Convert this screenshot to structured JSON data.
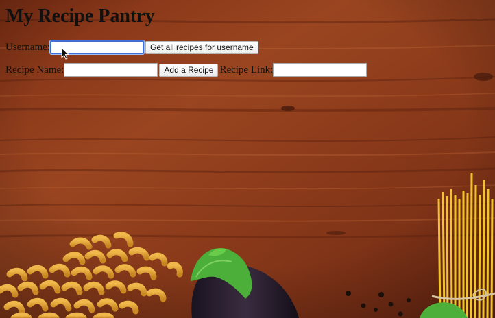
{
  "page": {
    "title": "My Recipe Pantry"
  },
  "search_row": {
    "username_label": "Username:",
    "username_value": "",
    "get_button_label": "Get all recipes for username"
  },
  "add_row": {
    "recipe_name_label": "Recipe Name:",
    "recipe_name_value": "",
    "add_button_label": "Add a Recipe",
    "recipe_link_label": "Recipe Link:",
    "recipe_link_value": ""
  },
  "colors": {
    "wood_dark": "#5e2410",
    "wood_mid": "#8c3a1a",
    "wood_light": "#a8542a",
    "focus_ring": "#3f6fd6",
    "pasta": "#e3a43a",
    "spaghetti": "#f1c232",
    "eggplant": "#2a1f2e",
    "leaf": "#4caf3a"
  },
  "icons": {
    "cursor": "mouse-pointer-icon"
  }
}
